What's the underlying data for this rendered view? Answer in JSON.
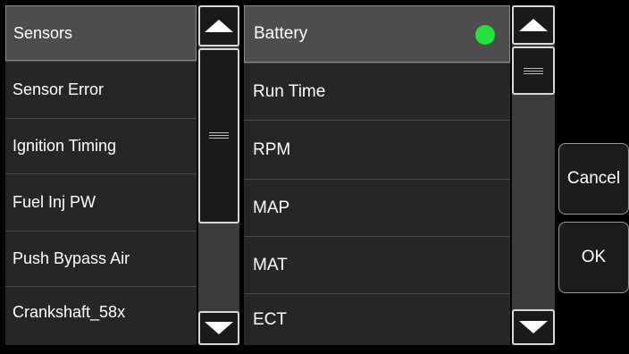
{
  "left_list": {
    "items": [
      "Sensors",
      "Sensor Error",
      "Ignition Timing",
      "Fuel Inj PW",
      "Push Bypass Air",
      "Crankshaft_58x"
    ],
    "selected": 0
  },
  "right_list": {
    "items": [
      "Battery",
      "Run Time",
      "RPM",
      "MAP",
      "MAT",
      "ECT"
    ],
    "status_dot_color": "#22e33a"
  },
  "scroll_icons": {
    "up": "triangle-up-icon",
    "down": "triangle-down-icon"
  },
  "buttons": {
    "cancel": "Cancel",
    "ok": "OK"
  }
}
